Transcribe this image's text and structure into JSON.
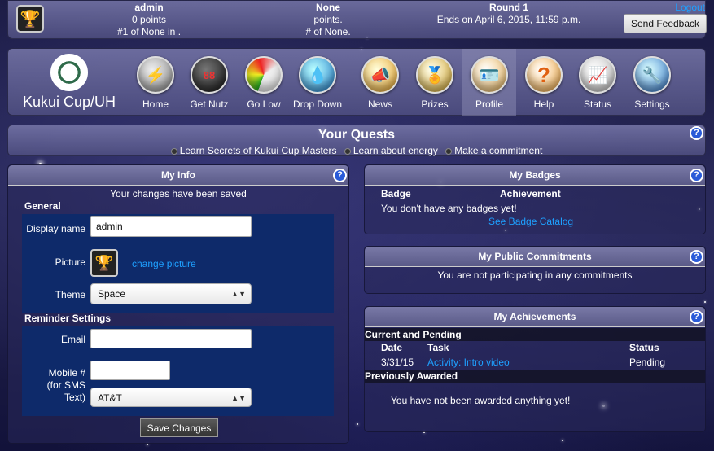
{
  "top": {
    "user": "admin",
    "points": "0 points",
    "rank": "#1 of None in .",
    "team": "None",
    "team_points": "points.",
    "team_rank": "# of None.",
    "round": "Round 1",
    "round_ends": "Ends on April 6, 2015, 11:59 p.m.",
    "logout": "Logout",
    "feedback": "Send Feedback"
  },
  "nav": {
    "brand": "Kukui Cup/UH",
    "items": [
      {
        "label": "Home",
        "icon": "trophy-icon"
      },
      {
        "label": "Get Nutz",
        "icon": "meter-display-icon"
      },
      {
        "label": "Go Low",
        "icon": "gauge-icon"
      },
      {
        "label": "Drop Down",
        "icon": "water-drop-icon"
      },
      {
        "label": "News",
        "icon": "megaphone-icon"
      },
      {
        "label": "Prizes",
        "icon": "medal-icon"
      },
      {
        "label": "Profile",
        "icon": "profile-card-icon"
      },
      {
        "label": "Help",
        "icon": "question-icon"
      },
      {
        "label": "Status",
        "icon": "chart-icon"
      },
      {
        "label": "Settings",
        "icon": "wrench-icon"
      }
    ]
  },
  "quests": {
    "title": "Your Quests",
    "items": [
      "Learn Secrets of Kukui Cup Masters",
      "Learn about energy",
      "Make a commitment"
    ]
  },
  "myinfo": {
    "title": "My Info",
    "saved": "Your changes have been saved",
    "general": "General",
    "display_name_label": "Display name",
    "display_name": "admin",
    "picture_label": "Picture",
    "change_picture": "change picture",
    "theme_label": "Theme",
    "theme": "Space",
    "reminder": "Reminder Settings",
    "email_label": "Email",
    "email": "",
    "mobile_label1": "Mobile #",
    "mobile_label2": "(for SMS",
    "mobile_label3": "Text)",
    "mobile": "",
    "carrier": "AT&T",
    "save": "Save Changes"
  },
  "badges": {
    "title": "My Badges",
    "col1": "Badge",
    "col2": "Achievement",
    "empty": "You don't have any badges yet!",
    "catalog": "See Badge Catalog"
  },
  "commitments": {
    "title": "My Public Commitments",
    "empty": "You are not participating in any commitments"
  },
  "achievements": {
    "title": "My Achievements",
    "current": "Current and Pending",
    "col_date": "Date",
    "col_task": "Task",
    "col_status": "Status",
    "rows": [
      {
        "date": "3/31/15",
        "task": "Activity: Intro video",
        "status": "Pending"
      }
    ],
    "previous": "Previously Awarded",
    "empty": "You have not been awarded anything yet!"
  },
  "help_label": "?",
  "colors": {
    "link": "#1ea0ff",
    "form_bg": "#0e2a6a"
  }
}
